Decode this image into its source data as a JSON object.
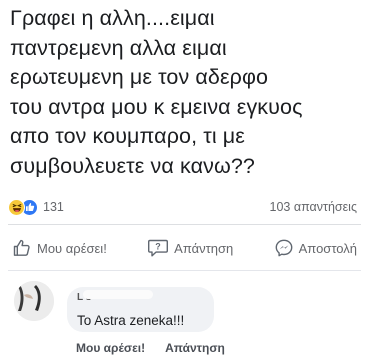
{
  "post": {
    "text_lines": [
      "Γραφει η αλλη....ειμαι",
      "παντρεμενη αλλα ειμαι",
      "ερωτευμενη με τον αδερφο",
      "του αντρα μου κ εμεινα εγκυος",
      "απο τον κουμπαρο, τι με",
      "συμβουλευετε να κανω??"
    ]
  },
  "reactions": {
    "icons": [
      "haha-icon",
      "like-icon"
    ],
    "count": "131",
    "comments_count": "103 απαντήσεις"
  },
  "actions": {
    "like_label": "Μου αρέσει!",
    "reply_label": "Απάντηση",
    "send_label": "Αποστολή"
  },
  "comment": {
    "author_visible": "L                    s",
    "text": "To Astra zeneka!!!",
    "like_label": "Μου αρέσει!",
    "reply_label": "Απάντηση"
  },
  "colors": {
    "text_primary": "#1c1e21",
    "text_secondary": "#65676b",
    "haha_yellow": "#f7c93a",
    "like_blue": "#2f78f4",
    "bubble_bg": "#f0f2f5"
  }
}
